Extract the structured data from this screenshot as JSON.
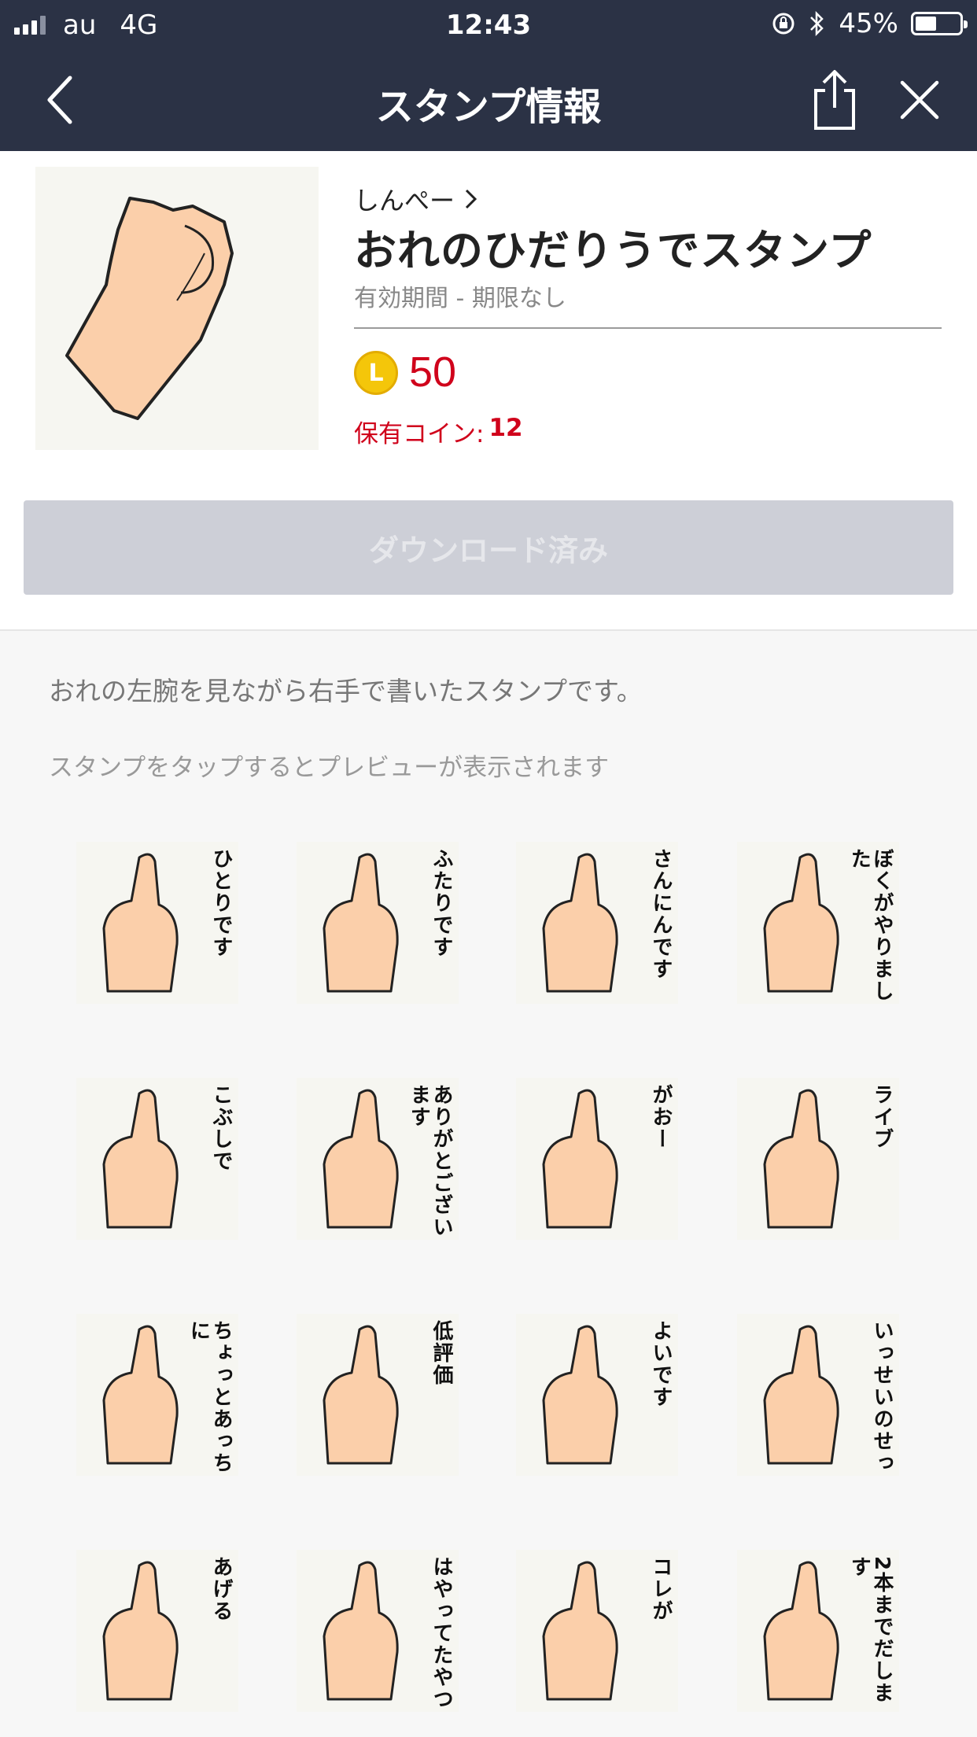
{
  "status_bar": {
    "carrier": "au",
    "network": "4G",
    "time": "12:43",
    "battery": "45%"
  },
  "nav": {
    "title": "スタンプ情報",
    "icons": [
      "back-chevron-icon",
      "share-icon",
      "close-icon"
    ]
  },
  "sticker_info": {
    "author": "しんぺー",
    "title": "おれのひだりうでスタンプ",
    "validity": "有効期間 - 期限なし",
    "coin_letter": "L",
    "price": "50",
    "owned_label": "保有コイン:",
    "owned_value": "12",
    "download_button": "ダウンロード済み"
  },
  "description": "おれの左腕を見ながら右手で書いたスタンプです。",
  "preview_hint": "スタンプをタップするとプレビューが表示されます",
  "stickers": [
    {
      "label": "ひとりです"
    },
    {
      "label": "ふたりです"
    },
    {
      "label": "さんにんです"
    },
    {
      "label": "ぼくがやりました"
    },
    {
      "label": "こぶしで"
    },
    {
      "label": "ありがとございます"
    },
    {
      "label": "がおー"
    },
    {
      "label": "ライブ"
    },
    {
      "label": "ちょっとあっちに"
    },
    {
      "label": "低評価"
    },
    {
      "label": "よいです"
    },
    {
      "label": "いっせいのせっ"
    },
    {
      "label": "あげる"
    },
    {
      "label": "はやってたやつ"
    },
    {
      "label": "コレが"
    },
    {
      "label": "2本までだします"
    }
  ],
  "colors": {
    "nav_bg": "#2b3245",
    "price_red": "#d0021b",
    "button_disabled": "#cdcfd7",
    "skin": "#fbcfaa"
  }
}
